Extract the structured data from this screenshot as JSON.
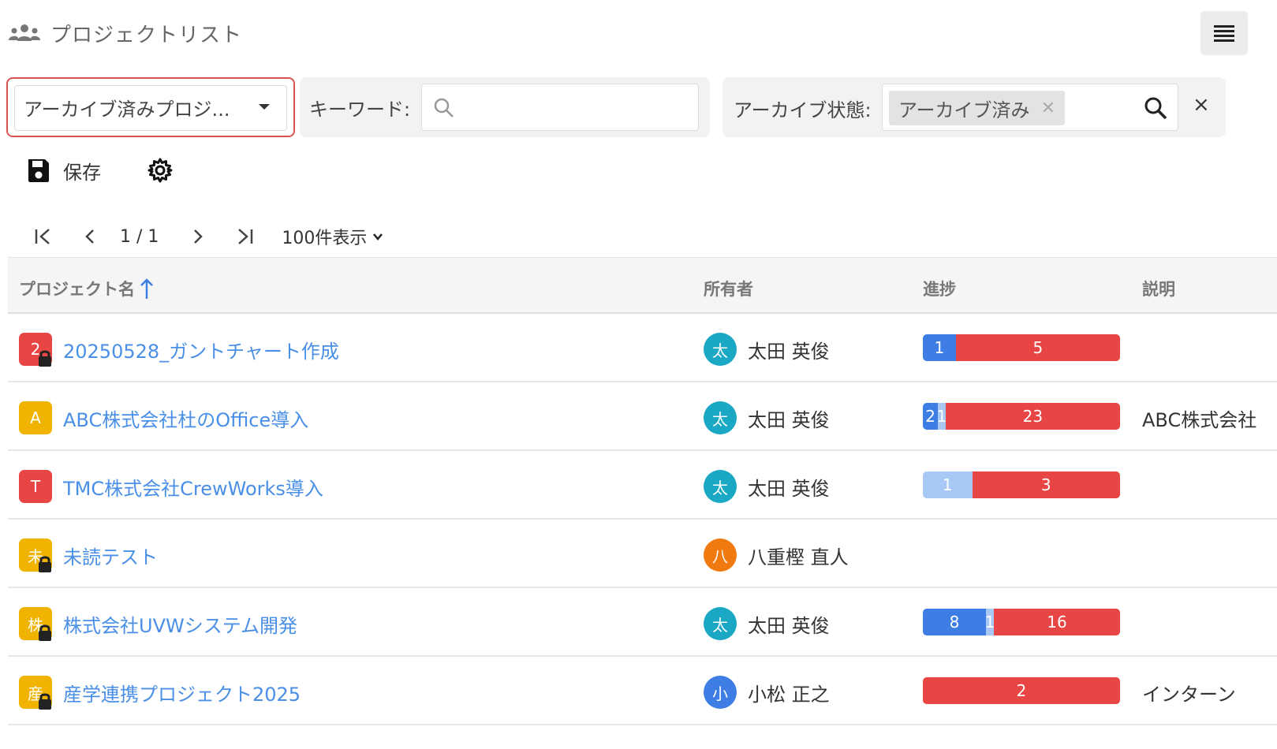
{
  "header": {
    "title": "プロジェクトリスト",
    "icon": "people-group-icon"
  },
  "filters": {
    "view_select": {
      "value": "アーカイブ済みプロジ...",
      "highlight_color": "#d9534f"
    },
    "keyword": {
      "label": "キーワード:",
      "value": "",
      "placeholder": ""
    },
    "archive_status": {
      "label": "アーカイブ状態:",
      "chip": "アーカイブ済み"
    }
  },
  "toolbar": {
    "save_label": "保存"
  },
  "pagination": {
    "page_info": "1 / 1",
    "per_page": "100件表示"
  },
  "table": {
    "headers": {
      "name": "プロジェクト名",
      "owner": "所有者",
      "progress": "進捗",
      "description": "説明"
    },
    "rows": [
      {
        "icon_letter": "2",
        "icon_color": "#e84545",
        "locked": true,
        "name": "20250528_ガントチャート作成",
        "owner_initial": "太",
        "owner_color": "#1aa8c4",
        "owner": "太田 英俊",
        "progress": [
          {
            "label": "1",
            "value": 1,
            "color": "#3d7de4"
          },
          {
            "label": "5",
            "value": 5,
            "color": "#e84545"
          }
        ],
        "description": ""
      },
      {
        "icon_letter": "A",
        "icon_color": "#f0b400",
        "locked": false,
        "name": "ABC株式会社杜のOffice導入",
        "owner_initial": "太",
        "owner_color": "#1aa8c4",
        "owner": "太田 英俊",
        "progress": [
          {
            "label": "2",
            "value": 2,
            "color": "#3d7de4"
          },
          {
            "label": "1",
            "value": 1,
            "color": "#a8c8f5"
          },
          {
            "label": "23",
            "value": 23,
            "color": "#e84545"
          }
        ],
        "description": "ABC株式会社"
      },
      {
        "icon_letter": "T",
        "icon_color": "#e84545",
        "locked": false,
        "name": "TMC株式会社CrewWorks導入",
        "owner_initial": "太",
        "owner_color": "#1aa8c4",
        "owner": "太田 英俊",
        "progress": [
          {
            "label": "1",
            "value": 1,
            "color": "#a8c8f5"
          },
          {
            "label": "3",
            "value": 3,
            "color": "#e84545"
          }
        ],
        "description": ""
      },
      {
        "icon_letter": "未",
        "icon_color": "#f0b400",
        "locked": true,
        "name": "未読テスト",
        "owner_initial": "八",
        "owner_color": "#f07a10",
        "owner": "八重樫 直人",
        "progress": [],
        "description": ""
      },
      {
        "icon_letter": "株",
        "icon_color": "#f0b400",
        "locked": true,
        "name": "株式会社UVWシステム開発",
        "owner_initial": "太",
        "owner_color": "#1aa8c4",
        "owner": "太田 英俊",
        "progress": [
          {
            "label": "8",
            "value": 8,
            "color": "#3d7de4"
          },
          {
            "label": "1",
            "value": 1,
            "color": "#a8c8f5"
          },
          {
            "label": "16",
            "value": 16,
            "color": "#e84545"
          }
        ],
        "description": ""
      },
      {
        "icon_letter": "産",
        "icon_color": "#f0b400",
        "locked": true,
        "name": "産学連携プロジェクト2025",
        "owner_initial": "小",
        "owner_color": "#3d7de4",
        "owner": "小松 正之",
        "progress": [
          {
            "label": "2",
            "value": 2,
            "color": "#e84545"
          }
        ],
        "description": "インターン"
      }
    ]
  }
}
